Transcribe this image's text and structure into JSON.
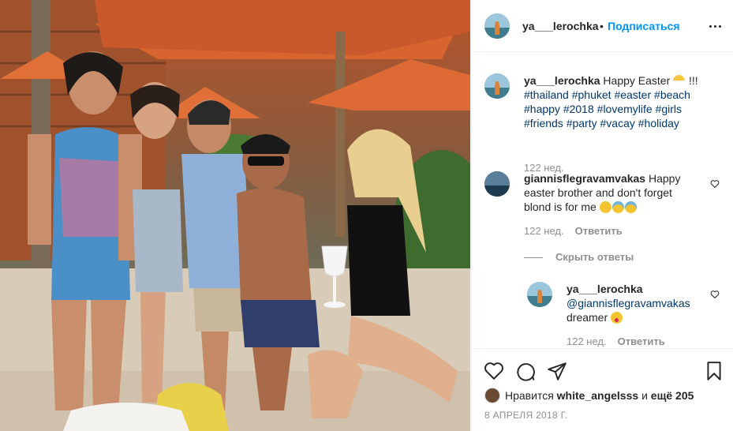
{
  "post": {
    "username": "ya___lerochka",
    "follow_label": "Подписаться",
    "dot": "•"
  },
  "caption": {
    "username": "ya___lerochka",
    "text": "Happy Easter",
    "after_emoji": " !!!",
    "hashtags": [
      "#thailand",
      "#phuket",
      "#easter",
      "#beach",
      "#happy",
      "#2018",
      "#lovemylife",
      "#girls",
      "#friends",
      "#party",
      "#vacay",
      "#holiday"
    ],
    "age": "122 нед."
  },
  "comments": [
    {
      "username": "giannisflegravamvakas",
      "text": "Happy easter brother and don't forget blond is for me",
      "age": "122 нед.",
      "reply_label": "Ответить",
      "emojis": [
        "face-emoji",
        "sweat-face-emoji",
        "sweat-face-emoji"
      ]
    }
  ],
  "hide_replies_label": "Скрыть ответы",
  "replies": [
    {
      "username": "ya___lerochka",
      "mention": "@giannisflegravamvakas",
      "text": " dreamer",
      "age": "122 нед.",
      "reply_label": "Ответить",
      "emojis": [
        "tongue-face-emoji"
      ]
    }
  ],
  "likes": {
    "prefix": "Нравится",
    "user": "white_angelsss",
    "middle": "и",
    "count_text": "ещё 205"
  },
  "date": "8 АПРЕЛЯ 2018 Г.",
  "icons": {
    "more": "more-options-icon",
    "like": "heart-icon",
    "comment": "comment-icon",
    "share": "paper-plane-icon",
    "save": "bookmark-icon"
  },
  "colors": {
    "link": "#0095f6",
    "hashtag": "#00376b",
    "muted": "#8e8e8e",
    "text": "#262626"
  }
}
